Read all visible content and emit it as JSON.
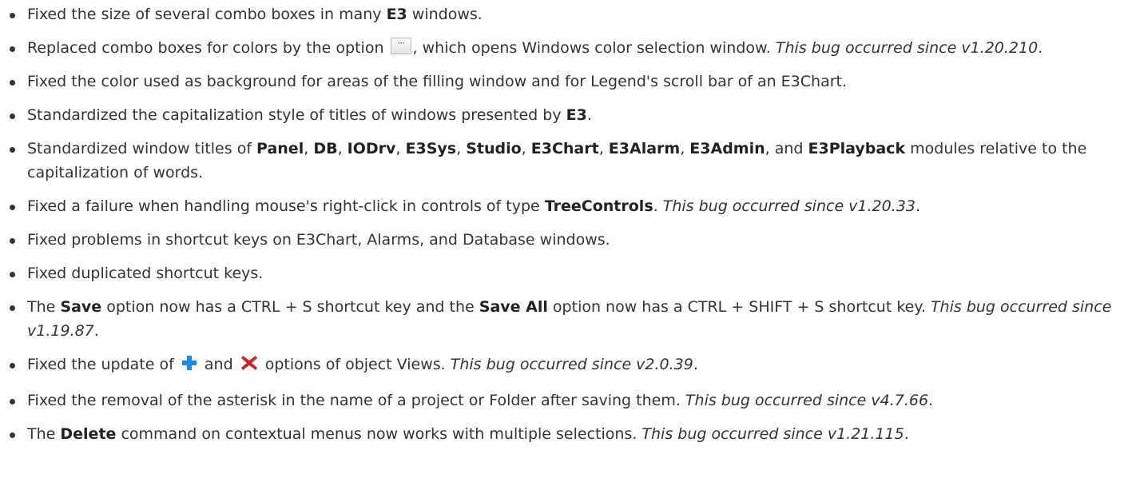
{
  "notes": [
    {
      "prefix": "Fixed the size of several combo boxes in many ",
      "bold": "E3",
      "suffix": " windows."
    },
    {
      "prefix": "Replaced combo boxes for colors by the option ",
      "button_glyph": "···",
      "suffix": ", which opens Windows color selection window. ",
      "bug": "This bug occurred since v1.20.210",
      "end": "."
    },
    {
      "text": "Fixed the color used as background for areas of the filling window and for Legend's scroll bar of an E3Chart."
    },
    {
      "prefix": "Standardized the capitalization style of titles of windows presented by ",
      "bold": "E3",
      "suffix": "."
    },
    {
      "prefix": "Standardized window titles of ",
      "modules": [
        "Panel",
        "DB",
        "IODrv",
        "E3Sys",
        "Studio",
        "E3Chart",
        "E3Alarm",
        "E3Admin",
        "E3Playback"
      ],
      "sep": ", ",
      "and_sep": ", and ",
      "suffix": " modules relative to the capitalization of words."
    },
    {
      "prefix": "Fixed a failure when handling mouse's right-click in controls of type ",
      "bold": "TreeControls",
      "mid": ". ",
      "bug": "This bug occurred since v1.20.33",
      "end": "."
    },
    {
      "text": "Fixed problems in shortcut keys on E3Chart, Alarms, and Database windows."
    },
    {
      "text": "Fixed duplicated shortcut keys."
    },
    {
      "p1": "The ",
      "b1": "Save",
      "p2": " option now has a CTRL + S shortcut key and the ",
      "b2": "Save All",
      "p3": " option now has a CTRL + SHIFT + S shortcut key. ",
      "bug": "This bug occurred since v1.19.87",
      "end": "."
    },
    {
      "prefix": "Fixed the update of ",
      "and": " and ",
      "suffix": " options of object Views. ",
      "bug": "This bug occurred since v2.0.39",
      "end": "."
    },
    {
      "prefix": "Fixed the removal of the asterisk in the name of a project or Folder after saving them. ",
      "bug": "This bug occurred since v4.7.66",
      "end": "."
    },
    {
      "p1": "The ",
      "bold": "Delete",
      "p2": " command on contextual menus now works with multiple selections. ",
      "bug": "This bug occurred since v1.21.115",
      "end": "."
    }
  ],
  "icons": {
    "plus": "plus-icon",
    "remove": "x-icon",
    "plus_color": "#1e88e5",
    "remove_color": "#c62828"
  }
}
